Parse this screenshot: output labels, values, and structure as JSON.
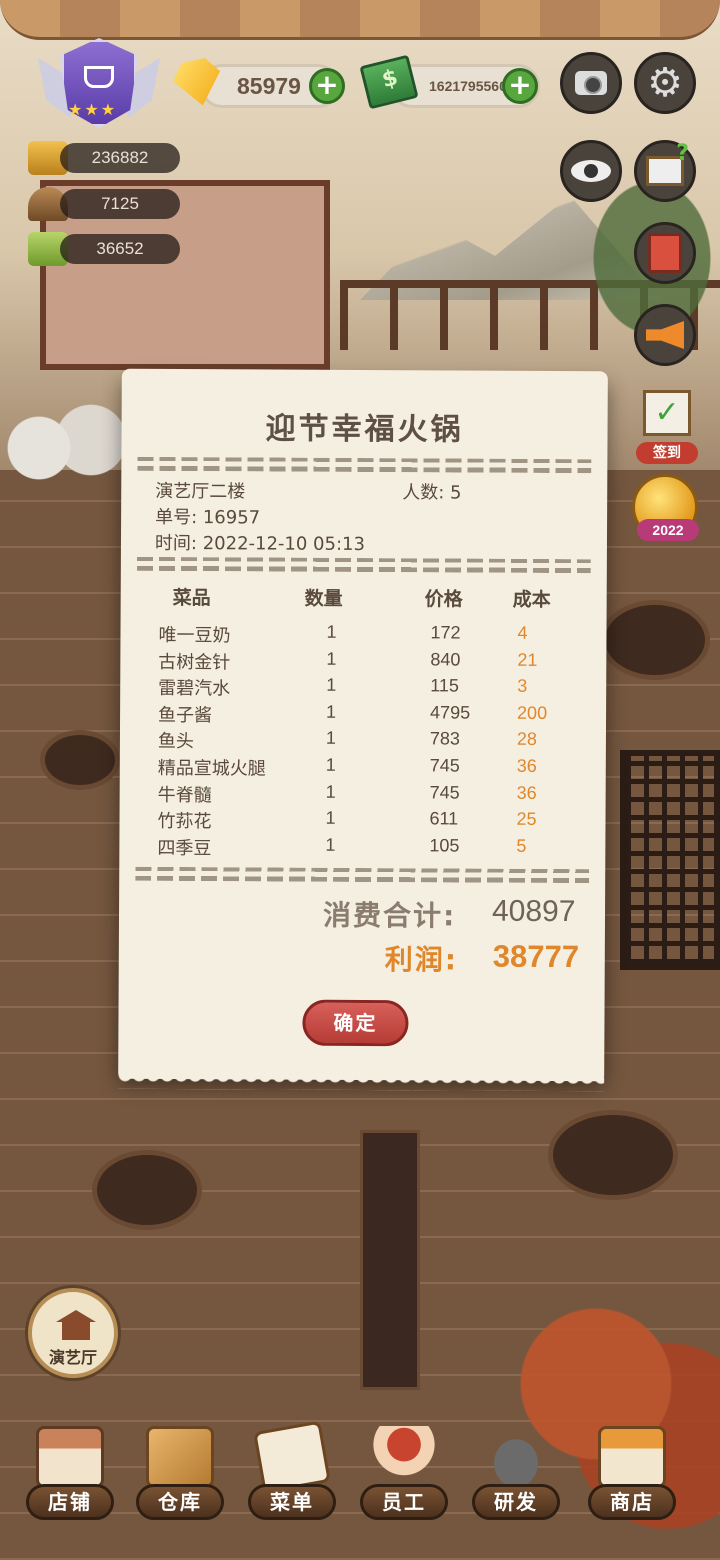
{
  "hud": {
    "gems": "85979",
    "cash": "1621795560",
    "stats": [
      "236882",
      "7125",
      "36652"
    ]
  },
  "side": {
    "checkin_label": "签到",
    "event_year": "2022"
  },
  "receipt": {
    "title": "迎节幸福火锅",
    "room": "演艺厅二楼",
    "guests": "人数: 5",
    "order_no": "单号: 16957",
    "time": "时间: 2022-12-10 05:13",
    "columns": [
      "菜品",
      "数量",
      "价格",
      "成本"
    ],
    "items": [
      {
        "name": "唯一豆奶",
        "qty": "1",
        "price": "172",
        "cost": "4"
      },
      {
        "name": "古树金针",
        "qty": "1",
        "price": "840",
        "cost": "21"
      },
      {
        "name": "雷碧汽水",
        "qty": "1",
        "price": "115",
        "cost": "3"
      },
      {
        "name": "鱼子酱",
        "qty": "1",
        "price": "4795",
        "cost": "200"
      },
      {
        "name": "鱼头",
        "qty": "1",
        "price": "783",
        "cost": "28"
      },
      {
        "name": "精品宣城火腿",
        "qty": "1",
        "price": "745",
        "cost": "36"
      },
      {
        "name": "牛脊髓",
        "qty": "1",
        "price": "745",
        "cost": "36"
      },
      {
        "name": "竹荪花",
        "qty": "1",
        "price": "611",
        "cost": "25"
      },
      {
        "name": "四季豆",
        "qty": "1",
        "price": "105",
        "cost": "5"
      }
    ],
    "total_label": "消费合计:",
    "total_value": "40897",
    "profit_label": "利润:",
    "profit_value": "38777",
    "confirm": "确定"
  },
  "hall_button": "演艺厅",
  "nav": [
    "店铺",
    "仓库",
    "菜单",
    "员工",
    "研发",
    "商店"
  ],
  "colors": {
    "profit": "#e0872b",
    "confirm": "#c6493f",
    "plus": "#58a63e"
  }
}
